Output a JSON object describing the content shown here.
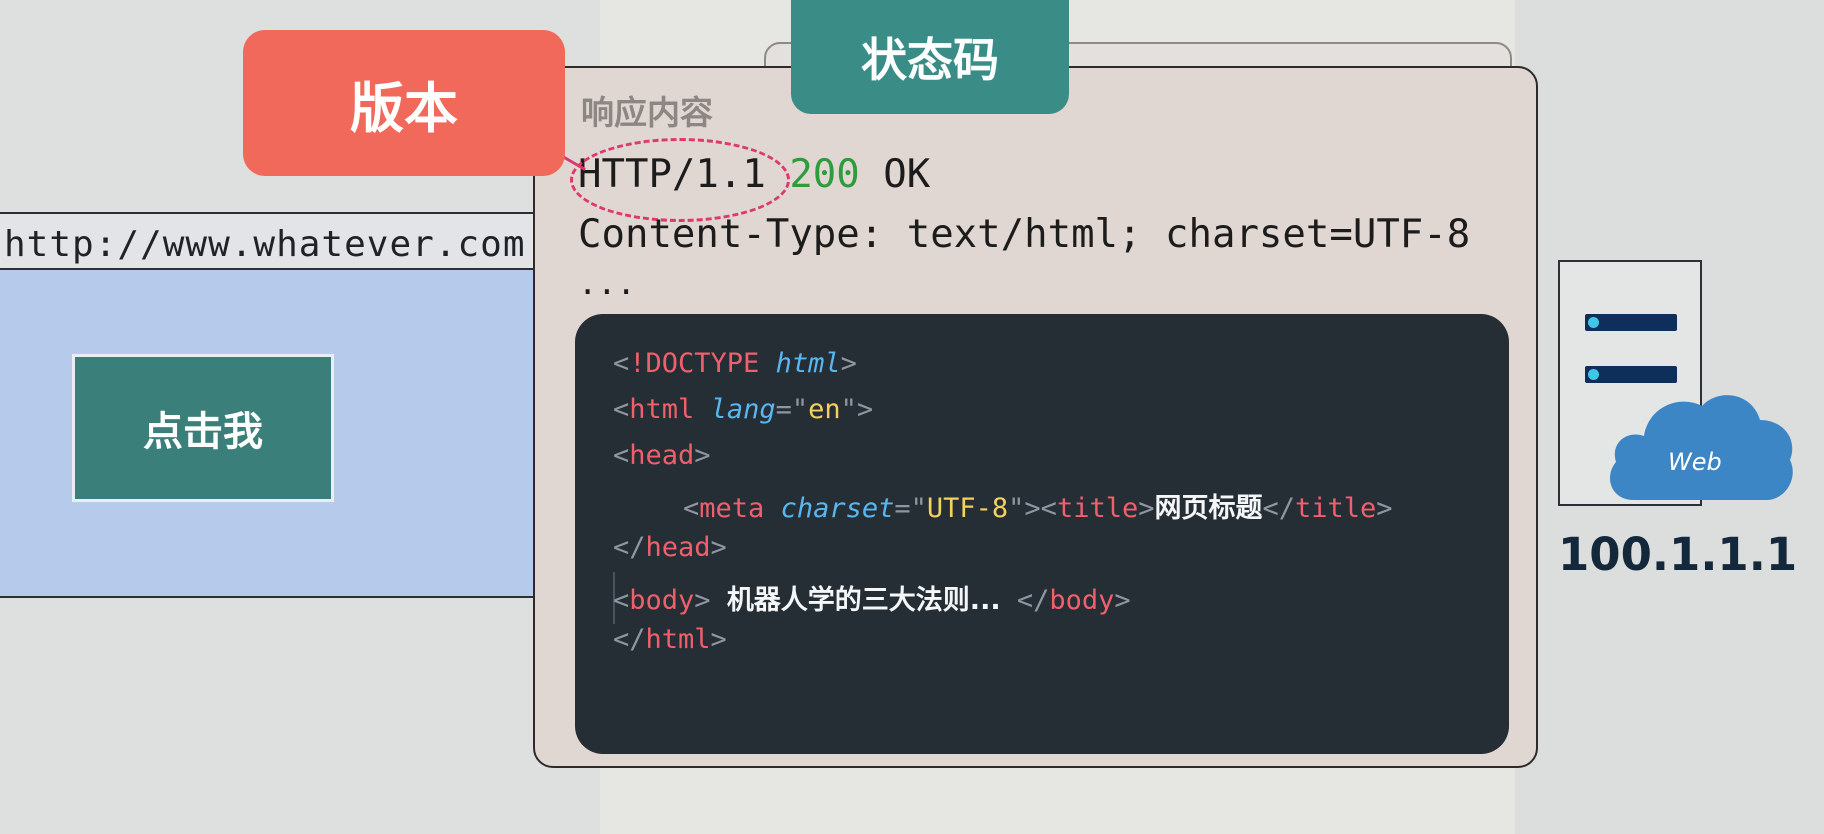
{
  "browser": {
    "url": "http://www.whatever.com",
    "button_label": "点击我"
  },
  "labels": {
    "version": "版本",
    "status_code": "状态码"
  },
  "response": {
    "title": "响应内容",
    "version": "HTTP/1.1",
    "status_code": "200",
    "status_text": "OK",
    "header_line": "Content-Type: text/html; charset=UTF-8",
    "ellipsis": "..."
  },
  "code": {
    "doctype_keyword": "!DOCTYPE",
    "doctype_value": "html",
    "html_tag": "html",
    "lang_attr": "lang",
    "lang_value": "en",
    "head_tag": "head",
    "meta_tag": "meta",
    "charset_attr": "charset",
    "charset_value": "UTF-8",
    "title_tag": "title",
    "title_text": "网页标题",
    "body_tag": "body",
    "body_text": "机器人学的三大法则..."
  },
  "server": {
    "cloud_label": "Web",
    "ip": "100.1.1.1"
  },
  "colors": {
    "version_tag": "#f0695a",
    "status_tag": "#3a8d86",
    "status_green": "#2e9b3c",
    "dashed_highlight": "#e0386d",
    "code_bg": "#252d35",
    "browser_bg": "#b6cbec",
    "button_bg": "#3a7f79",
    "cloud": "#3d86c6"
  }
}
